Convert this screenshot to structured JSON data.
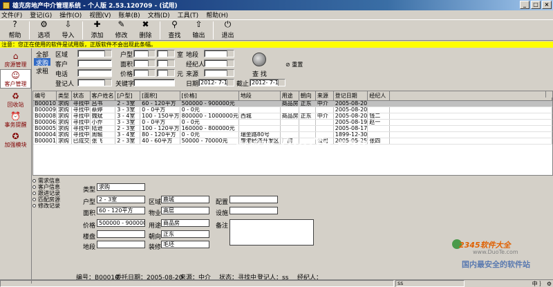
{
  "window": {
    "title": "雄克房地产中介管理系统 - 个人版 2.53.120709 - (试用)"
  },
  "menu": [
    "文件(F)",
    "登记(G)",
    "操作(O)",
    "视图(V)",
    "账单(B)",
    "文档(D)",
    "工具(T)",
    "帮助(H)"
  ],
  "toolbar": [
    {
      "label": "帮助",
      "icon": "help-icon",
      "glyph": "?"
    },
    {
      "label": "选项",
      "icon": "options-icon",
      "glyph": "⚙"
    },
    {
      "label": "导入",
      "icon": "import-icon",
      "glyph": "⇩"
    },
    {
      "label": "添加",
      "icon": "add-icon",
      "glyph": "✚"
    },
    {
      "label": "修改",
      "icon": "edit-icon",
      "glyph": "✎"
    },
    {
      "label": "删除",
      "icon": "delete-icon",
      "glyph": "✖"
    },
    {
      "label": "查找",
      "icon": "find-icon",
      "glyph": "⚲"
    },
    {
      "label": "输出",
      "icon": "export-icon",
      "glyph": "⇧"
    },
    {
      "label": "退出",
      "icon": "exit-icon",
      "glyph": "⏻"
    }
  ],
  "notice": "注意：您正在使用的软件是试用版，正版软件不会出现此条幅。",
  "nav": [
    {
      "label": "房源管理",
      "icon": "house-icon",
      "glyph": "⌂",
      "active": false
    },
    {
      "label": "客户管理",
      "icon": "customer-icon",
      "glyph": "☺",
      "active": true
    },
    {
      "label": "回收站",
      "icon": "recycle-icon",
      "glyph": "♻",
      "active": false
    },
    {
      "label": "事务提醒",
      "icon": "reminder-icon",
      "glyph": "⏰",
      "active": false
    },
    {
      "label": "加强模块",
      "icon": "module-icon",
      "glyph": "✪",
      "active": false
    }
  ],
  "search": {
    "types": [
      "全部",
      "求购",
      "求租"
    ],
    "selected_type": 1,
    "labels": {
      "district": "区域",
      "customer": "客户",
      "phone": "电话",
      "registrar": "登记人",
      "layout": "户型",
      "area": "面积",
      "price": "价格",
      "keyword": "关键字",
      "room": "室",
      "yuan": "元",
      "floor": "地段",
      "agent": "经纪人",
      "source": "来源",
      "date": "日期",
      "until": "截止"
    },
    "date_from": "2012- 7-11",
    "date_to": "2012- 7-11",
    "find_label": "查 找",
    "reset_label": "重置"
  },
  "grid": {
    "headers": [
      "编号",
      "类型",
      "状态",
      "客户姓名",
      "[户型]",
      "[面积]",
      "[价格]",
      "地段",
      "用途",
      "朝向",
      "来源",
      "登记日期",
      "经纪人"
    ],
    "rows": [
      [
        "B00010",
        "求购",
        "寻找中",
        "吕书",
        "2 - 3室",
        "60 - 120平方",
        "500000 - 900000元",
        "",
        "商品房",
        "正东",
        "中介",
        "2005-08-20",
        ""
      ],
      [
        "B00009",
        "求购",
        "寻找中",
        "蔡婷",
        "3 - 3室",
        "0 - 0平方",
        "0 - 0元",
        "",
        "",
        "",
        "",
        "2005-08-20",
        ""
      ],
      [
        "B00008",
        "求购",
        "寻找中",
        "魏斌",
        "3 - 4室",
        "100 - 150平方",
        "800000 - 1000000元",
        "西城",
        "商品房",
        "正东",
        "中介",
        "2005-08-20",
        "钱二"
      ],
      [
        "B00006",
        "求购",
        "寻找中",
        "小乔",
        "3 - 3室",
        "0 - 0平方",
        "0 - 0元",
        "",
        "",
        "",
        "",
        "2005-08-19",
        "赵一"
      ],
      [
        "B00005",
        "求购",
        "寻找中",
        "陆逊",
        "2 - 3室",
        "100 - 120平方",
        "160000 - 800000元",
        "",
        "",
        "",
        "",
        "2005-08-17",
        ""
      ],
      [
        "B00004",
        "求购",
        "寻找中",
        "周瑜",
        "3 - 4室",
        "80 - 120平方",
        "0 - 0元",
        "瑞金路80号",
        "",
        "",
        "",
        "1899-12-30",
        ""
      ],
      [
        "B00001",
        "求购",
        "已成交",
        "张飞",
        "2 - 3室",
        "40 - 60平方",
        "50000 - 70000元",
        "鹿港经济开发区",
        "厂房",
        "",
        "公司",
        "2005-05-25",
        "张四"
      ]
    ]
  },
  "detail_tabs": [
    "需求信息",
    "客户信息",
    "跟进记录",
    "匹配房源",
    "修改记录"
  ],
  "detail": {
    "type_label": "类型",
    "type": "求购",
    "layout_label": "户型",
    "layout": "2 - 3室",
    "district_label": "区域",
    "district": "鹿城",
    "config_label": "配置",
    "config": "",
    "area_label": "面积",
    "area": "60 - 120平方",
    "property_label": "物业",
    "property": "高层",
    "facility_label": "设施",
    "facility": "",
    "price_label": "价格",
    "price": "500000 - 900000元",
    "use_label": "用途",
    "use": "商品房",
    "note_label": "备注",
    "note": "",
    "floor_label": "楼盘",
    "floor": "",
    "orient_label": "朝向",
    "orient": "正东",
    "lot_label": "地段",
    "lot": "",
    "decor_label": "装修",
    "decor": "毛坯"
  },
  "status_row": {
    "id": "编号：B00010",
    "date": "委托日期：2005-08-20",
    "source": "来源：中介",
    "state": "状态：寻找中",
    "registrar": "登记人：ss",
    "agent": "经纪人："
  },
  "statusbar": {
    "cell1": "",
    "cell2": "ss",
    "ime": "中 ｝ ⚙"
  },
  "watermark": "www.DuoTe.com",
  "brand": {
    "line1": "2345软件大全",
    "line2": "www.DuoTe.com",
    "line3": "国内最安全的软件站"
  }
}
